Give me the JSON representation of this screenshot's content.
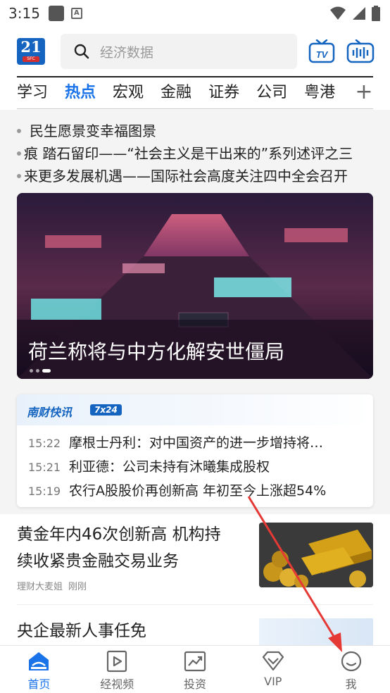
{
  "status_bar": {
    "time": "3:15",
    "notif_letter": "A"
  },
  "search": {
    "placeholder": "经济数据"
  },
  "logo": {
    "number": "21",
    "sub": "SFC"
  },
  "tabs": [
    "学习",
    "热点",
    "宏观",
    "金融",
    "证券",
    "公司",
    "粤港"
  ],
  "tabs_active_index": 1,
  "tab_add": "+",
  "headlines": [
    "民生愿景变幸福图景",
    "痕 踏石留印——“社会主义是干出来的”系列述评之三",
    "来更多发展机遇——国际社会高度关注四中全会召开"
  ],
  "hero": {
    "caption": "荷兰称将与中方化解安世僵局",
    "dot_count": 3,
    "active_dot": 2
  },
  "flash": {
    "brand": "南财快讯",
    "badge": "7x24",
    "items": [
      {
        "time": "15:22",
        "title": "摩根士丹利：对中国资产的进一步增持将…"
      },
      {
        "time": "15:21",
        "title": "利亚德：公司未持有沐曦集成股权"
      },
      {
        "time": "15:19",
        "title": "农行A股股价再创新高 年初至今上涨超54%"
      }
    ]
  },
  "article": {
    "title_line1": "黄金年内46次创新高 机构持",
    "title_line2": "续收紧贵金融交易业务",
    "source": "理财大麦姐",
    "time": "刚刚"
  },
  "article2": {
    "title": "央企最新人事任免"
  },
  "bottom_nav": {
    "items": [
      {
        "label": "首页",
        "icon": "home-icon"
      },
      {
        "label": "经视频",
        "icon": "video-icon"
      },
      {
        "label": "投资",
        "icon": "invest-icon"
      },
      {
        "label": "VIP",
        "icon": "vip-icon"
      },
      {
        "label": "我",
        "icon": "smiley-icon"
      }
    ],
    "active_index": 0
  },
  "colors": {
    "accent": "#1a73e8",
    "brand_blue": "#1565c0",
    "arrow": "#e53935"
  }
}
